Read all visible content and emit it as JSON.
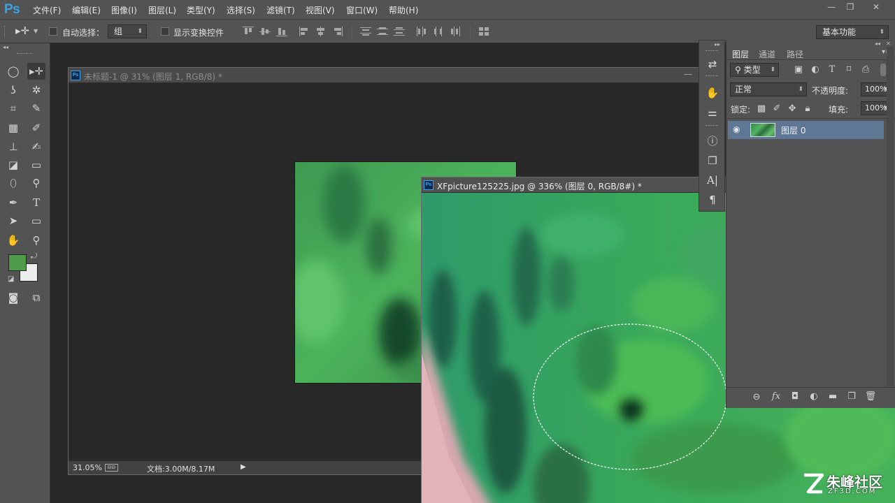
{
  "app": {
    "logo": "Ps"
  },
  "menu": [
    "文件(F)",
    "编辑(E)",
    "图像(I)",
    "图层(L)",
    "类型(Y)",
    "选择(S)",
    "滤镜(T)",
    "视图(V)",
    "窗口(W)",
    "帮助(H)"
  ],
  "window_controls": {
    "minimize": "—",
    "restore": "❐",
    "close": "✕"
  },
  "options": {
    "auto_select_label": "自动选择：",
    "auto_select_value": "组",
    "show_transform_label": "显示变换控件",
    "workspace": "基本功能"
  },
  "colors": {
    "foreground": "#4e9b4a",
    "background": "#ededed",
    "selected_layer": "#5d7795",
    "ps_blue": "#33a5f0"
  },
  "doc1": {
    "title": "未标题-1 @ 31% (图层 1, RGB/8) *",
    "zoom": "31.05%",
    "doc_info": "文档:3.00M/8.17M"
  },
  "doc2": {
    "title": "XFpicture125225.jpg @ 336% (图层 0, RGB/8#) *"
  },
  "layers_panel": {
    "tabs": [
      "图层",
      "通道",
      "路径"
    ],
    "filter_label": "类型",
    "blend_mode": "正常",
    "opacity_label": "不透明度:",
    "opacity_value": "100%",
    "lock_label": "锁定:",
    "fill_label": "填充:",
    "fill_value": "100%",
    "layers": [
      {
        "name": "图层 0",
        "visible": true,
        "selected": true
      }
    ]
  },
  "watermark": {
    "brand": "朱峰社区",
    "url": "ZF3D.COM"
  }
}
